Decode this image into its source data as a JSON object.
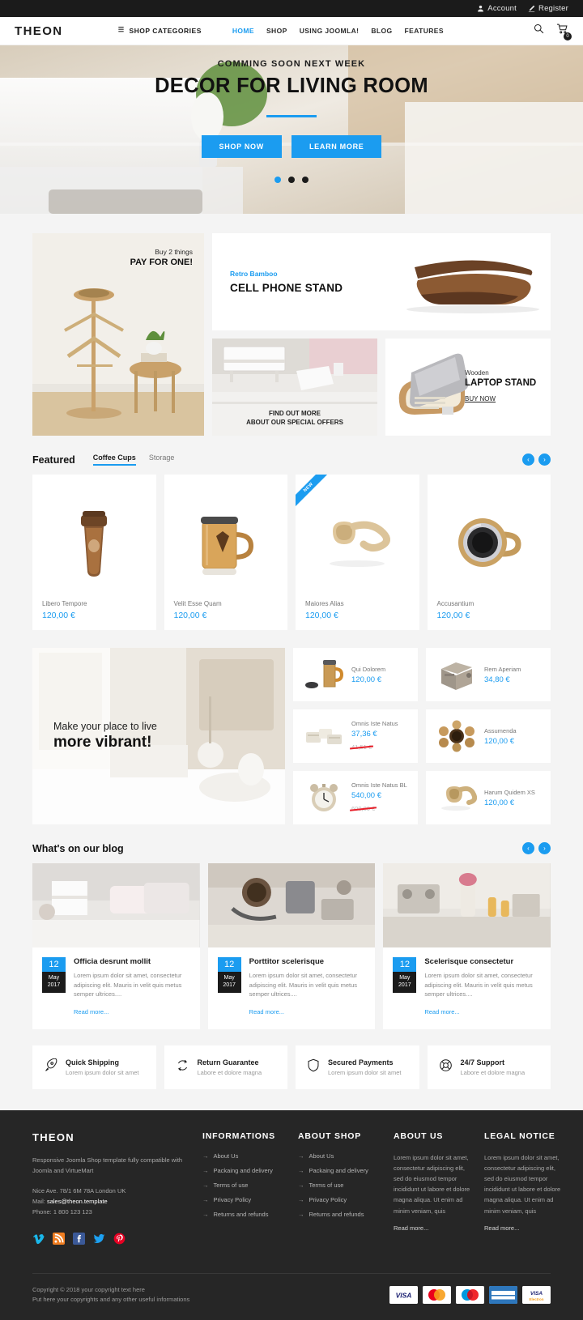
{
  "topbar": {
    "account": "Account",
    "register": "Register"
  },
  "header": {
    "logo": "THEON",
    "shop_categories": "SHOP CATEGORIES",
    "nav": [
      {
        "label": "HOME",
        "active": true
      },
      {
        "label": "SHOP",
        "active": false
      },
      {
        "label": "USING JOOMLA!",
        "active": false
      },
      {
        "label": "BLOG",
        "active": false
      },
      {
        "label": "FEATURES",
        "active": false
      }
    ],
    "cart_count": "0"
  },
  "hero": {
    "subtitle": "COMMING SOON NEXT WEEK",
    "title": "DECOR FOR LIVING ROOM",
    "btn_primary": "SHOP NOW",
    "btn_secondary": "LEARN MORE",
    "slides": 3,
    "active_slide": 1
  },
  "promo": {
    "tall": {
      "line1": "Buy 2 things",
      "line2": "PAY FOR ONE!"
    },
    "wide": {
      "eyebrow": "Retro Bamboo",
      "title": "CELL PHONE STAND"
    },
    "bottom_left": {
      "line1": "FIND OUT MORE",
      "line2": "ABOUT OUR SPECIAL OFFERS"
    },
    "bottom_right": {
      "line1": "Wooden",
      "line2": "LAPTOP STAND",
      "cta": "BUY NOW"
    }
  },
  "featured": {
    "title": "Featured",
    "tabs": [
      {
        "label": "Coffee Cups",
        "active": true
      },
      {
        "label": "Storage",
        "active": false
      }
    ],
    "prev": "‹",
    "next": "›",
    "products": [
      {
        "name": "Libero Tempore",
        "price": "120,00 €",
        "badge": ""
      },
      {
        "name": "Velit Esse Quam",
        "price": "120,00 €",
        "badge": ""
      },
      {
        "name": "Maiores Alias",
        "price": "120,00 €",
        "badge": "NEW"
      },
      {
        "name": "Accusantium",
        "price": "120,00 €",
        "badge": ""
      }
    ]
  },
  "banner": {
    "line1": "Make your place to live",
    "line2": "more vibrant!"
  },
  "mini_products": [
    {
      "name": "Qui Dolorem",
      "price": "120,00 €",
      "old_price": ""
    },
    {
      "name": "Rem Aperiam",
      "price": "34,80 €",
      "old_price": ""
    },
    {
      "name": "Omnis Iste Natus",
      "price": "37,36 €",
      "old_price": "41,51 €"
    },
    {
      "name": "Assumenda",
      "price": "120,00 €",
      "old_price": ""
    },
    {
      "name": "Omnis Iste Natus BL",
      "price": "540,00 €",
      "old_price": "600,00 €"
    },
    {
      "name": "Harum Quidem XS",
      "price": "120,00 €",
      "old_price": ""
    }
  ],
  "blog": {
    "title": "What's on our blog",
    "prev": "‹",
    "next": "›",
    "posts": [
      {
        "day": "12",
        "month": "May",
        "year": "2017",
        "title": "Officia desrunt mollit",
        "excerpt": "Lorem ipsum dolor sit amet, consectetur adipiscing elit. Mauris in velit quis metus semper ultrices....",
        "readmore": "Read more..."
      },
      {
        "day": "12",
        "month": "May",
        "year": "2017",
        "title": "Porttitor scelerisque",
        "excerpt": "Lorem ipsum dolor sit amet, consectetur adipiscing elit. Mauris in velit quis metus semper ultrices....",
        "readmore": "Read more..."
      },
      {
        "day": "12",
        "month": "May",
        "year": "2017",
        "title": "Scelerisque consectetur",
        "excerpt": "Lorem ipsum dolor sit amet, consectetur adipiscing elit. Mauris in velit quis metus semper ultrices....",
        "readmore": "Read more..."
      }
    ]
  },
  "services": [
    {
      "icon": "rocket-icon",
      "title": "Quick Shipping",
      "subtitle": "Lorem ipsum dolor sit amet"
    },
    {
      "icon": "refresh-icon",
      "title": "Return Guarantee",
      "subtitle": "Labore et dolore magna"
    },
    {
      "icon": "shield-icon",
      "title": "Secured Payments",
      "subtitle": "Lorem ipsum dolor sit amet"
    },
    {
      "icon": "lifebuoy-icon",
      "title": "24/7 Support",
      "subtitle": "Labore et dolore magna"
    }
  ],
  "footer": {
    "brand": "THEON",
    "brand_desc": "Responsive Joomla Shop template fully compatible with Joomla and VirtueMart",
    "address": "Nice Ave. 78/1 6M 78A London UK",
    "mail_label": "Mail:",
    "mail": "sales@theon.template",
    "phone_label": "Phone:",
    "phone": "1 800 123 123",
    "social": [
      "vimeo-icon",
      "rss-icon",
      "facebook-icon",
      "twitter-icon",
      "pinterest-icon"
    ],
    "columns": [
      {
        "heading": "INFORMATIONS",
        "links": [
          "About Us",
          "Packaing and delivery",
          "Terms of use",
          "Privacy Policy",
          "Returns and refunds"
        ]
      },
      {
        "heading": "ABOUT SHOP",
        "links": [
          "About Us",
          "Packaing and delivery",
          "Terms of use",
          "Privacy Policy",
          "Returns and refunds"
        ]
      }
    ],
    "text_columns": [
      {
        "heading": "ABOUT US",
        "body": "Lorem ipsum dolor sit amet, consectetur adipiscing elit, sed do eiusmod tempor incididunt ut labore et dolore magna aliqua. Ut enim ad minim veniam, quis",
        "readmore": "Read more..."
      },
      {
        "heading": "LEGAL NOTICE",
        "body": "Lorem ipsum dolor sit amet, consectetur adipiscing elit, sed do eiusmod tempor incididunt ut labore et dolore magna aliqua. Ut enim ad minim veniam, quis",
        "readmore": "Read more..."
      }
    ],
    "copyright_line1": "Copyright © 2018 your copyright text here",
    "copyright_line2": "Put here your copyrights and any other useful informations",
    "payments": [
      "VISA",
      "MasterCard",
      "Maestro",
      "AMERICAN EXPRESS",
      "VISA Electron"
    ]
  },
  "colors": {
    "accent": "#1b9cf0",
    "dark": "#1b1b1b",
    "footer_bg": "#262626",
    "page_bg": "#f4f4f4",
    "sale_red": "#e8202a"
  }
}
